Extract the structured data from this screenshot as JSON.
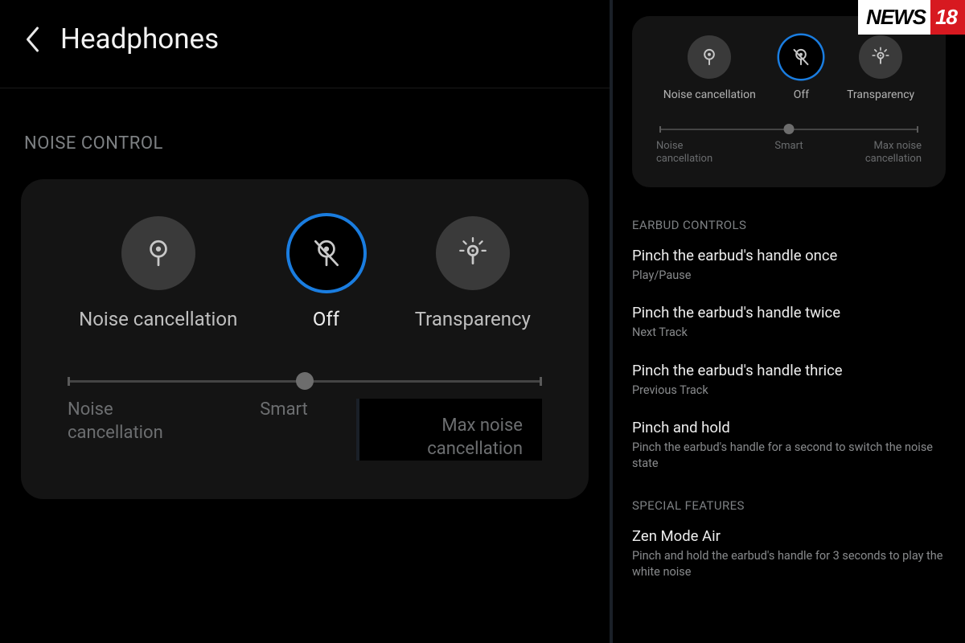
{
  "left": {
    "header": {
      "title": "Headphones"
    },
    "section_label": "NOISE CONTROL",
    "modes": [
      {
        "label": "Noise cancellation",
        "icon": "nc"
      },
      {
        "label": "Off",
        "icon": "off",
        "selected": true
      },
      {
        "label": "Transparency",
        "icon": "transparency"
      }
    ],
    "slider": {
      "labels": {
        "left": "Noise\ncancellation",
        "center": "Smart",
        "right": "Max noise\ncancellation"
      }
    }
  },
  "right": {
    "modes": [
      {
        "label": "Noise cancellation",
        "icon": "nc"
      },
      {
        "label": "Off",
        "icon": "off",
        "selected": true
      },
      {
        "label": "Transparency",
        "icon": "transparency"
      }
    ],
    "slider": {
      "labels": {
        "left": "Noise\ncancellation",
        "center": "Smart",
        "right": "Max noise\ncancellation"
      }
    },
    "section1_label": "EARBUD CONTROLS",
    "controls": [
      {
        "title": "Pinch the earbud's handle once",
        "sub": "Play/Pause"
      },
      {
        "title": "Pinch the earbud's handle twice",
        "sub": "Next Track"
      },
      {
        "title": "Pinch the earbud's handle thrice",
        "sub": "Previous Track"
      },
      {
        "title": "Pinch and hold",
        "sub": "Pinch the earbud's handle for a second to switch the noise state"
      }
    ],
    "section2_label": "SPECIAL FEATURES",
    "features": [
      {
        "title": "Zen Mode Air",
        "sub": "Pinch and hold the earbud's handle for 3 seconds to play the white noise"
      }
    ]
  },
  "logo": {
    "a": "NEWS",
    "b": "18"
  }
}
